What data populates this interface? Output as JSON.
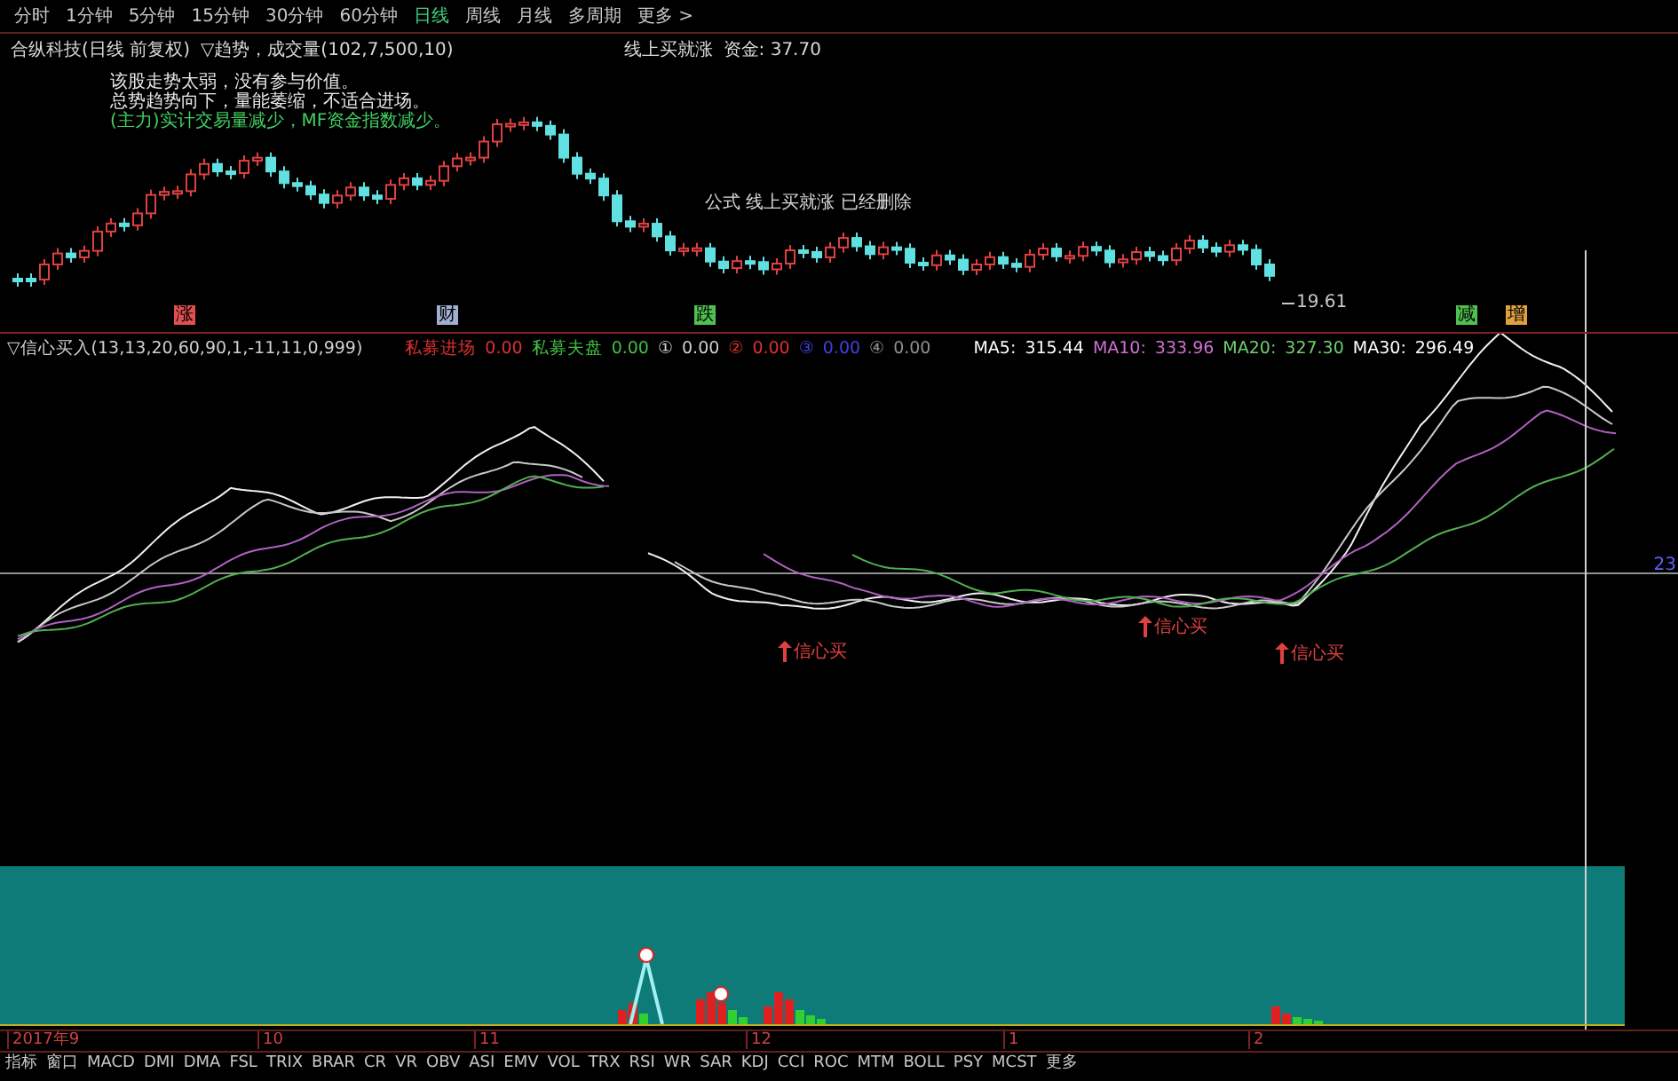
{
  "period_tabs": [
    {
      "label": "分时",
      "selected": false
    },
    {
      "label": "1分钟",
      "selected": false
    },
    {
      "label": "5分钟",
      "selected": false
    },
    {
      "label": "15分钟",
      "selected": false
    },
    {
      "label": "30分钟",
      "selected": false
    },
    {
      "label": "60分钟",
      "selected": false
    },
    {
      "label": "日线",
      "selected": true
    },
    {
      "label": "周线",
      "selected": false
    },
    {
      "label": "月线",
      "selected": false
    },
    {
      "label": "多周期",
      "selected": false
    },
    {
      "label": "更多 >",
      "selected": false
    }
  ],
  "main_chart": {
    "title": "合纵科技(日线 前复权)",
    "indicator": "▽趋势，成交量(102,7,500,10)",
    "formula_label": "线上买就涨",
    "formula_value": "资金: 37.70",
    "notes": [
      {
        "text": "该股走势太弱，没有参与价值。",
        "kind": "plain"
      },
      {
        "text": "总势趋势向下，量能萎缩，不适合进场。",
        "kind": "plain"
      },
      {
        "text": "(主力)实计交易量减少，MF资金指数减少。",
        "kind": "highlight"
      }
    ],
    "message": "公式 线上买就涨 已经删除",
    "markers": [
      {
        "text": "涨",
        "color": "#e05050"
      },
      {
        "text": "财",
        "color": "#a0b0d0"
      },
      {
        "text": "跌",
        "color": "#50c050"
      },
      {
        "text": "减",
        "color": "#50c050"
      },
      {
        "text": "增",
        "color": "#e0a040"
      }
    ],
    "price_label": "19.61"
  },
  "indicator_panel": {
    "title": "▽信心买入(13,13,20,60,90,1,-11,11,0,999)",
    "readings": [
      {
        "label": "私募进场",
        "value": "0.00",
        "color": "#e03030"
      },
      {
        "label": "私募夫盘",
        "value": "0.00",
        "color": "#40c040"
      },
      {
        "label": "①",
        "value": "0.00",
        "color": "#d0d0d0"
      },
      {
        "label": "②",
        "value": "0.00",
        "color": "#e03030"
      },
      {
        "label": "③",
        "value": "0.00",
        "color": "#4040e0"
      },
      {
        "label": "④",
        "value": "0.00",
        "color": "#909090"
      }
    ],
    "ma": [
      {
        "label": "MA5:",
        "value": "315.44",
        "color": "#ffffff"
      },
      {
        "label": "MA10:",
        "value": "333.96",
        "color": "#d070d0"
      },
      {
        "label": "MA20:",
        "value": "327.30",
        "color": "#70d070"
      },
      {
        "label": "MA30:",
        "value": "296.49",
        "color": "#ffffff"
      }
    ],
    "signals": [
      "信心买",
      "信心买",
      "信心买"
    ],
    "axis_value": "23"
  },
  "date_axis": [
    "2017年9",
    "10",
    "11",
    "12",
    "1",
    "2"
  ],
  "indicator_tabs": [
    "指标",
    "窗口",
    "MACD",
    "DMI",
    "DMA",
    "FSL",
    "TRIX",
    "BRAR",
    "CR",
    "VR",
    "OBV",
    "ASI",
    "EMV",
    "VOL",
    "TRX",
    "RSI",
    "WR",
    "SAR",
    "KDJ",
    "CCI",
    "ROC",
    "MTM",
    "BOLL",
    "PSY",
    "MCST",
    "更多"
  ]
}
